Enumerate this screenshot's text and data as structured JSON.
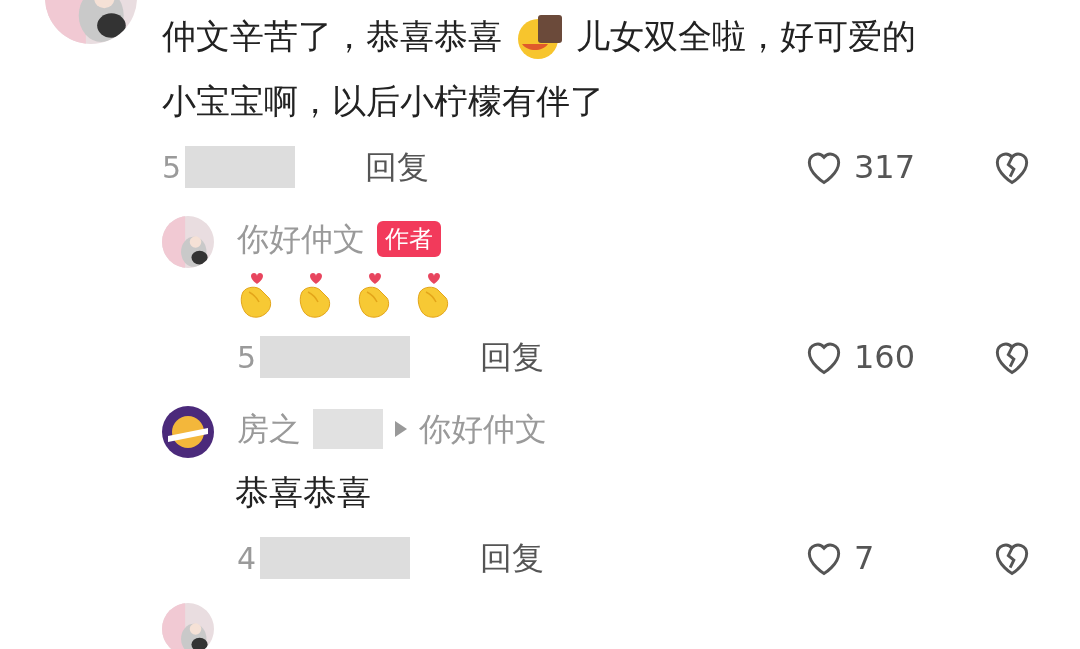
{
  "comments": [
    {
      "avatar": {
        "kind": "picture"
      },
      "body": [
        {
          "kind": "text",
          "text": "仲文辛苦了，恭喜恭喜"
        },
        {
          "kind": "emoji"
        },
        {
          "kind": "text",
          "text": "儿女双全啦，好可爱的"
        },
        {
          "kind": "break"
        },
        {
          "kind": "text",
          "text": "小宝宝啊，以后小柠檬有伴了"
        }
      ],
      "time": "5",
      "reply_label": "回复",
      "likes": "317",
      "replies": [
        {
          "avatar": {
            "kind": "picture"
          },
          "author": "你好仲文",
          "badge": "作者",
          "body": [
            {
              "kind": "finger_heart"
            },
            {
              "kind": "finger_heart"
            },
            {
              "kind": "finger_heart"
            },
            {
              "kind": "finger_heart"
            }
          ],
          "time": "5",
          "reply_label": "回复",
          "likes": "160"
        },
        {
          "avatar": {
            "kind": "team_logo"
          },
          "author": "房之",
          "reply_to": "你好仲文",
          "body": [
            {
              "kind": "text",
              "text": "恭喜恭喜"
            }
          ],
          "time": "4",
          "reply_label": "回复",
          "likes": "7"
        }
      ]
    }
  ]
}
